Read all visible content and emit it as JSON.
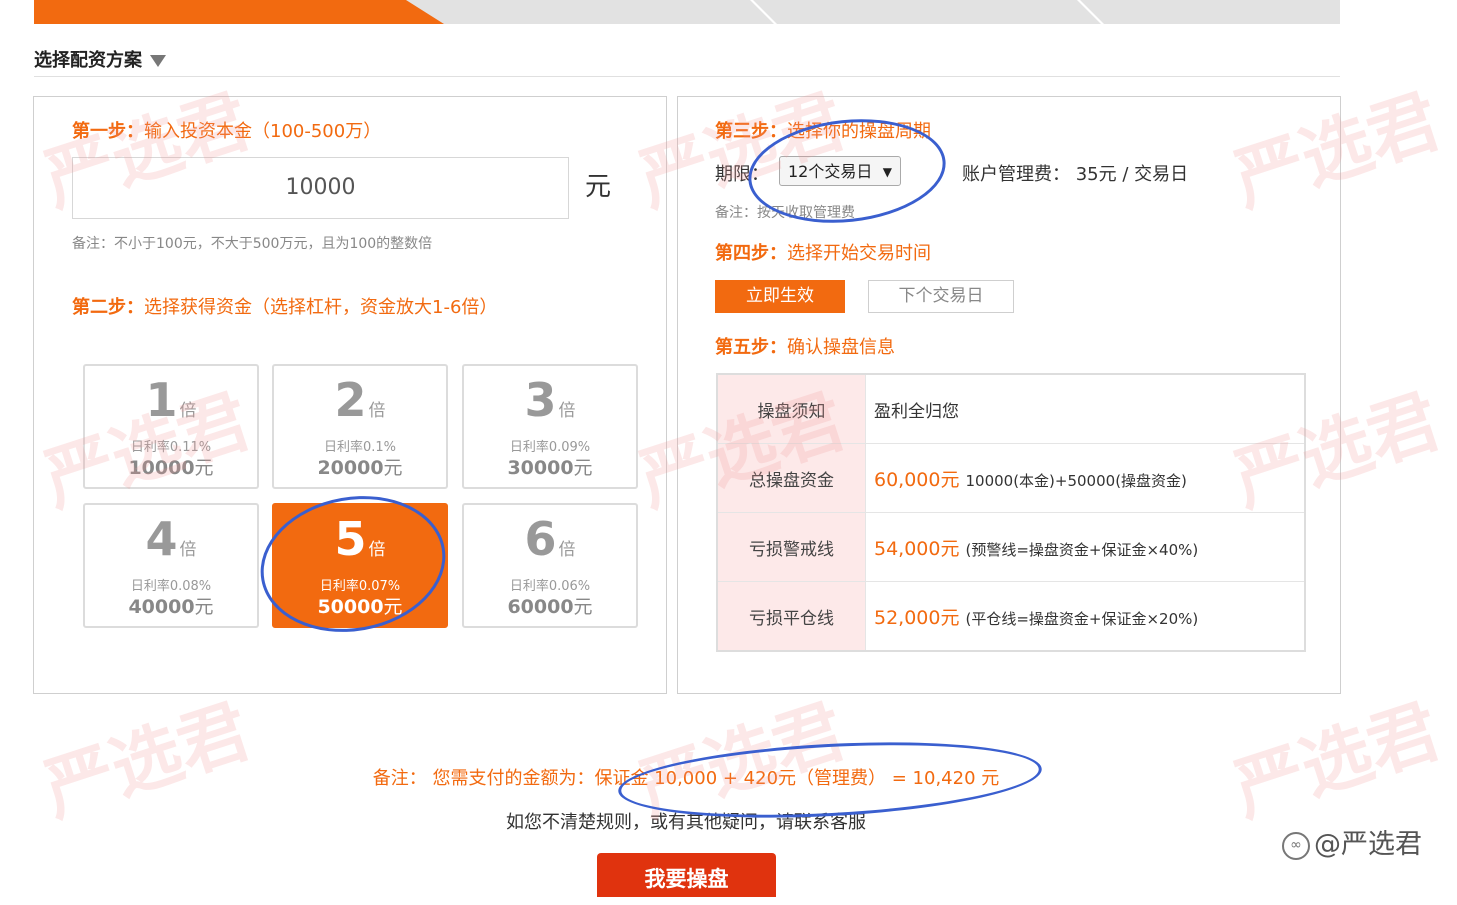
{
  "section_title": "选择配资方案",
  "step1": {
    "prefix": "第一步：",
    "label": "输入投资本金（100-500万）",
    "amount_value": "10000",
    "unit": "元",
    "note": "备注：不小于100元，不大于500万元，且为100的整数倍"
  },
  "step2": {
    "prefix": "第二步：",
    "label": "选择获得资金（选择杠杆，资金放大1-6倍）",
    "multiplier_unit": "倍",
    "currency_unit": "元",
    "options": [
      {
        "mult": "1",
        "rate": "日利率0.11%",
        "amount": "10000"
      },
      {
        "mult": "2",
        "rate": "日利率0.1%",
        "amount": "20000"
      },
      {
        "mult": "3",
        "rate": "日利率0.09%",
        "amount": "30000"
      },
      {
        "mult": "4",
        "rate": "日利率0.08%",
        "amount": "40000"
      },
      {
        "mult": "5",
        "rate": "日利率0.07%",
        "amount": "50000"
      },
      {
        "mult": "6",
        "rate": "日利率0.06%",
        "amount": "60000"
      }
    ],
    "selected_index": 4
  },
  "step3": {
    "prefix": "第三步：",
    "label": "选择你的操盘周期",
    "period_label": "期限：",
    "period_value": "12个交易日",
    "fee_label": "账户管理费：",
    "fee_value": "35元 / 交易日",
    "note": "备注：按天收取管理费"
  },
  "step4": {
    "prefix": "第四步：",
    "label": "选择开始交易时间",
    "btn_now": "立即生效",
    "btn_next": "下个交易日"
  },
  "step5": {
    "prefix": "第五步：",
    "label": "确认操盘信息",
    "rows": [
      {
        "key": "操盘须知",
        "highlight": "",
        "detail": "盈利全归您"
      },
      {
        "key": "总操盘资金",
        "highlight": "60,000元",
        "detail": "10000(本金)+50000(操盘资金)"
      },
      {
        "key": "亏损警戒线",
        "highlight": "54,000元",
        "detail": "(预警线=操盘资金+保证金×40%)"
      },
      {
        "key": "亏损平仓线",
        "highlight": "52,000元",
        "detail": "(平仓线=操盘资金+保证金×20%)"
      }
    ]
  },
  "footer": {
    "pay_note": "备注： 您需支付的金额为：保证金 10,000 + 420元（管理费） = 10,420 元",
    "help_text": "如您不清楚规则，或有其他疑问，请联系客服",
    "submit_button": "我要操盘"
  },
  "watermark": "严选君",
  "source_label": "@严选君",
  "colors": {
    "accent": "#f26a10",
    "submit": "#e0330e",
    "annotation": "#3a5fcf",
    "table_key_bg": "#fde9e9"
  }
}
